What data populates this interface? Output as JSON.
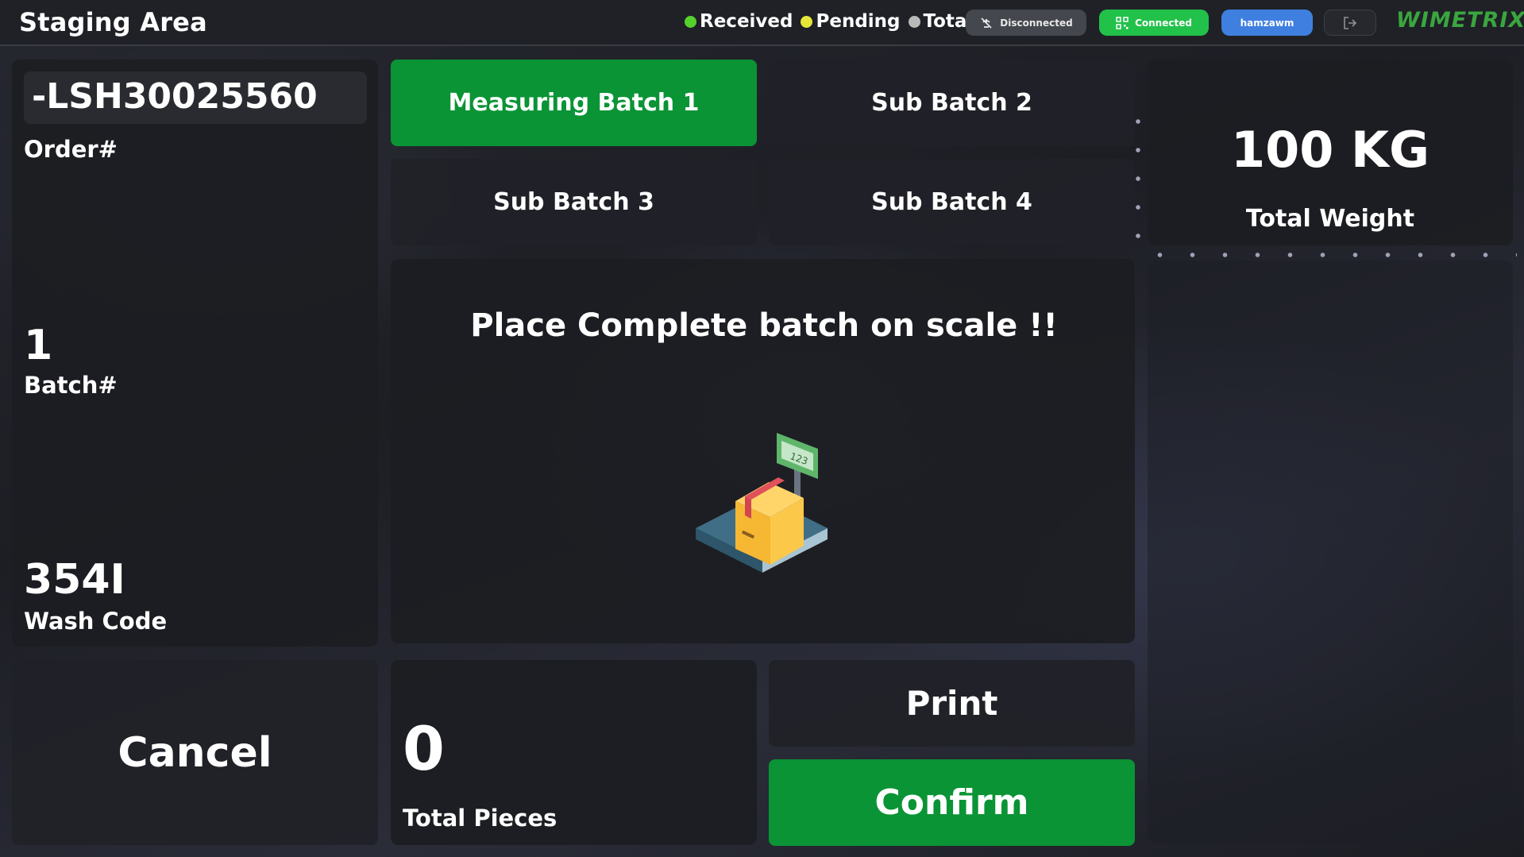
{
  "header": {
    "title": "Staging Area",
    "legend": [
      {
        "label": "Received",
        "color": "#54d12b"
      },
      {
        "label": "Pending",
        "color": "#e5e838"
      },
      {
        "label": "Total",
        "color": "#b9b9b9"
      }
    ],
    "disconnected_label": "Disconnected",
    "connected_label": "Connected",
    "user_label": "hamzawm",
    "brand": "WIMETRIX"
  },
  "order": {
    "order_id": "-LSH30025560",
    "order_label": "Order#",
    "batch_value": "1",
    "batch_label": "Batch#",
    "wash_code_value": "354I",
    "wash_code_label": "Wash Code"
  },
  "batches": {
    "tab1": "Measuring Batch 1",
    "tab2": "Sub Batch 2",
    "tab3": "Sub Batch 3",
    "tab4": "Sub Batch 4"
  },
  "scale": {
    "message": "Place Complete batch on scale !!",
    "display_text": "123"
  },
  "weight": {
    "value": "100 KG",
    "label": "Total Weight"
  },
  "actions": {
    "cancel": "Cancel",
    "print": "Print",
    "confirm": "Confirm"
  },
  "pieces": {
    "value": "0",
    "label": "Total Pieces"
  }
}
